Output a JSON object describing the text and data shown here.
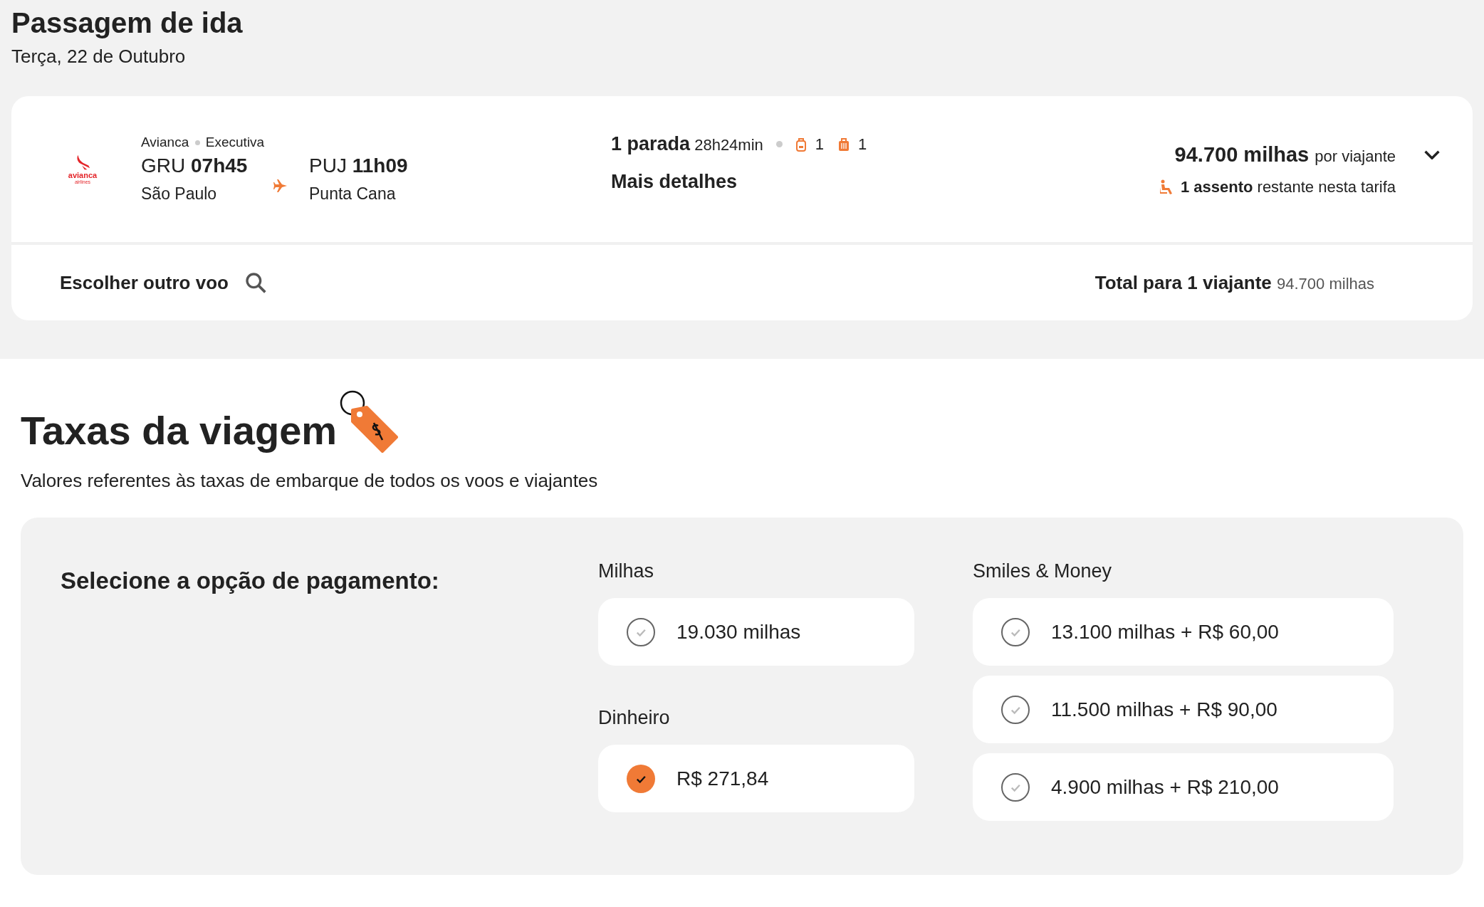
{
  "header": {
    "title": "Passagem de ida",
    "date": "Terça, 22 de Outubro"
  },
  "flight": {
    "logo": {
      "name": "avianca",
      "sub": "airlines"
    },
    "airline": "Avianca",
    "cabin": "Executiva",
    "origin": {
      "code": "GRU",
      "time": "07h45",
      "city": "São Paulo"
    },
    "destination": {
      "code": "PUJ",
      "time": "11h09",
      "city": "Punta Cana"
    },
    "stops": "1 parada",
    "duration": "28h24min",
    "baggage": [
      {
        "kind": "backpack",
        "count": "1"
      },
      {
        "kind": "suitcase",
        "count": "1"
      }
    ],
    "details_link": "Mais detalhes",
    "price": "94.700 milhas",
    "price_unit": "por viajante",
    "seats": "1 assento",
    "seats_note": "restante nesta tarifa",
    "expanded": false,
    "other_flight": "Escolher outro voo",
    "total_label": "Total para 1 viajante",
    "total_value": "94.700 milhas"
  },
  "fees": {
    "title": "Taxas da viagem",
    "subtitle": "Valores referentes às taxas de embarque de todos os voos e viajantes",
    "prompt": "Selecione a opção de pagamento:",
    "columns": [
      [
        {
          "label": "Milhas",
          "options": [
            {
              "text": "19.030 milhas",
              "selected": false
            }
          ]
        },
        {
          "label": "Dinheiro",
          "options": [
            {
              "text": "R$ 271,84",
              "selected": true
            }
          ]
        }
      ],
      [
        {
          "label": "Smiles & Money",
          "options": [
            {
              "text": "13.100 milhas + R$ 60,00",
              "selected": false
            },
            {
              "text": "11.500 milhas + R$ 90,00",
              "selected": false
            },
            {
              "text": "4.900 milhas + R$ 210,00",
              "selected": false
            }
          ]
        }
      ]
    ]
  }
}
